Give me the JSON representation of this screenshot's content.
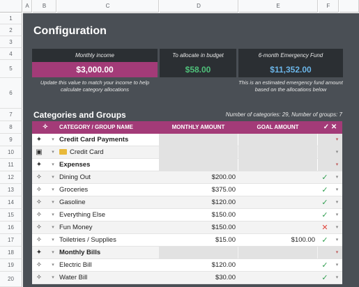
{
  "columns": [
    "A",
    "B",
    "C",
    "D",
    "E",
    "F"
  ],
  "rows": [
    "1",
    "2",
    "3",
    "4",
    "5",
    "6",
    "7",
    "8",
    "9",
    "10",
    "11",
    "12",
    "13",
    "14",
    "15",
    "16",
    "17",
    "18",
    "19",
    "20"
  ],
  "title": "Configuration",
  "cards": {
    "income": {
      "label": "Monthly income",
      "value": "$3,000.00",
      "note": "Update this value to match your income to help calculate category allocations"
    },
    "allocate": {
      "label": "To allocate in budget",
      "value": "$58.00"
    },
    "emergency": {
      "label": "6-month Emergency Fund",
      "value": "$11,352.00",
      "note": "This is an estimated emergency fund amount based on the allocations below"
    }
  },
  "section": {
    "title": "Categories and Groups",
    "count": "Number of categories: 29, Number of groups: 7"
  },
  "table": {
    "headers": {
      "icon": "✧",
      "name": "CATEGORY / GROUP NAME",
      "monthly": "MONTHLY AMOUNT",
      "goal": "GOAL AMOUNT",
      "status": "✓ ✕"
    },
    "rows": [
      {
        "kind": "group",
        "name": "Credit Card Payments",
        "monthly": "",
        "goal": "",
        "status": "",
        "dd_red": true
      },
      {
        "kind": "card",
        "name": "Credit Card",
        "monthly": "",
        "goal": "",
        "status": ""
      },
      {
        "kind": "group",
        "name": "Expenses",
        "monthly": "",
        "goal": "",
        "status": "",
        "dd_red": true
      },
      {
        "kind": "item",
        "name": "Dining Out",
        "monthly": "$200.00",
        "goal": "",
        "status": "check"
      },
      {
        "kind": "item",
        "name": "Groceries",
        "monthly": "$375.00",
        "goal": "",
        "status": "check"
      },
      {
        "kind": "item",
        "name": "Gasoline",
        "monthly": "$120.00",
        "goal": "",
        "status": "check"
      },
      {
        "kind": "item",
        "name": "Everything Else",
        "monthly": "$150.00",
        "goal": "",
        "status": "check"
      },
      {
        "kind": "item",
        "name": "Fun Money",
        "monthly": "$150.00",
        "goal": "",
        "status": "cross"
      },
      {
        "kind": "item",
        "name": "Toiletries / Supplies",
        "monthly": "$15.00",
        "goal": "$100.00",
        "status": "check"
      },
      {
        "kind": "group",
        "name": "Monthly Bills",
        "monthly": "",
        "goal": "",
        "status": "",
        "dd_red": true
      },
      {
        "kind": "item",
        "name": "Electric Bill",
        "monthly": "$120.00",
        "goal": "",
        "status": "check"
      },
      {
        "kind": "item",
        "name": "Water Bill",
        "monthly": "$30.00",
        "goal": "",
        "status": "check"
      }
    ]
  },
  "colors": {
    "panel": "#4a4f55",
    "accent": "#a33b78",
    "income": "#ffffff",
    "allocate": "#4fc07a",
    "emergency": "#6bb5e8",
    "check": "#2e9e4e",
    "cross": "#e0443b"
  }
}
